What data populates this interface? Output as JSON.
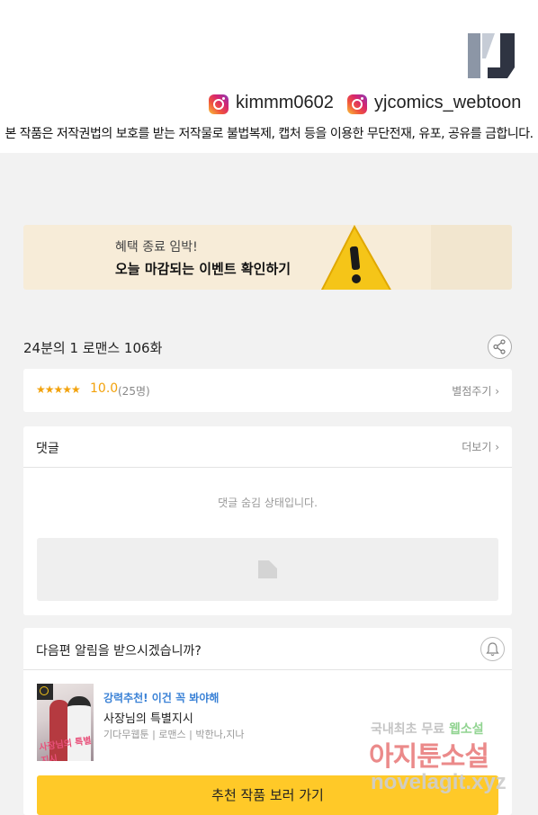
{
  "header": {
    "logo_icon": "yjcomics-logo",
    "instagram_1": "kimmm0602",
    "instagram_2": "yjcomics_webtoon",
    "notice": "본 작품은 저작권법의 보호를 받는 저작물로 불법복제, 캡처 등을 이용한 무단전재, 유포, 공유를 금합니다."
  },
  "banner": {
    "subtitle": "혜택 종료 임박!",
    "title": "오늘 마감되는 이벤트 확인하기",
    "icon": "warning-icon"
  },
  "episode": {
    "title": "24분의 1 로맨스 106화",
    "share_icon": "share-icon"
  },
  "rating": {
    "stars": "★★★★★",
    "score": "10.0",
    "count": "(25명)",
    "rate_label": "별점주기 ›"
  },
  "comments": {
    "title": "댓글",
    "more_label": "더보기 ›",
    "hidden_message": "댓글 숨김 상태입니다."
  },
  "next_alert": {
    "question": "다음편 알림을 받으시겠습니까?",
    "bell_icon": "bell-icon"
  },
  "recommendation": {
    "promo": "강력추천! 이건 꼭 봐야해",
    "title": "사장님의 특별지시",
    "meta": "기다무웹툰 | 로맨스 | 박한나,지나",
    "thumbnail_title": "사장님의 특별지시",
    "cta": "추천 작품 보러 가기"
  },
  "watermark": {
    "line1_a": "국내최초 무료",
    "line1_b": "웹소설",
    "line2": "아지툰소설",
    "line3": "novelagit.xyz"
  },
  "colors": {
    "accent_yellow": "#ffc928",
    "rating_orange": "#f2a20c",
    "promo_blue": "#3b82d6",
    "banner_bg": "#f7ecd8"
  }
}
